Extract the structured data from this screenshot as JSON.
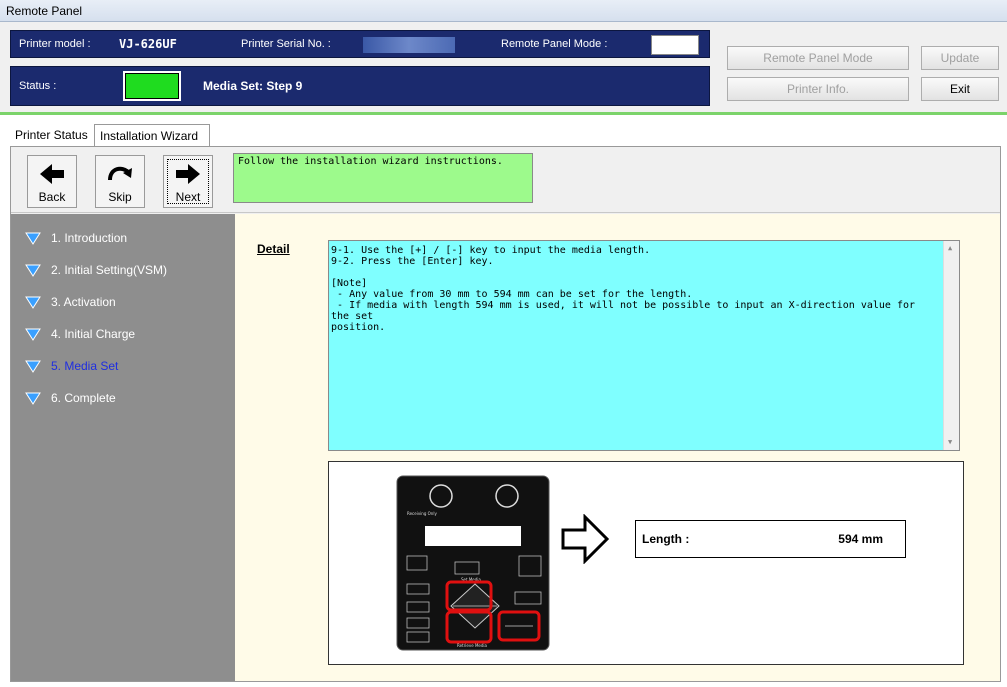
{
  "window": {
    "title": "Remote Panel"
  },
  "header": {
    "printer_model_label": "Printer model :",
    "printer_model": "VJ-626UF",
    "serial_label": "Printer Serial No. :",
    "remote_mode_label": "Remote Panel Mode :",
    "status_label": "Status :",
    "status_text": "Media Set: Step 9",
    "status_color": "#1fdc1f"
  },
  "buttons": {
    "remote_panel_mode": "Remote Panel Mode",
    "update": "Update",
    "printer_info": "Printer Info.",
    "exit": "Exit"
  },
  "tabs": [
    "Printer Status",
    "Installation Wizard"
  ],
  "toolbar": {
    "back": "Back",
    "skip": "Skip",
    "next": "Next",
    "message": "Follow the installation wizard instructions."
  },
  "steps": [
    {
      "label": "1. Introduction"
    },
    {
      "label": "2. Initial Setting(VSM)"
    },
    {
      "label": "3. Activation"
    },
    {
      "label": "4. Initial Charge"
    },
    {
      "label": "5. Media Set",
      "current": true
    },
    {
      "label": "6. Complete"
    }
  ],
  "detail": {
    "label": "Detail",
    "text": "9-1. Use the [+] / [-] key to input the media length.\n9-2. Press the [Enter] key.\n\n[Note]\n - Any value from 30 mm to 594 mm can be set for the length.\n - If media with length 594 mm is used, it will not be possible to input an X-direction value for the set\nposition."
  },
  "illustration": {
    "panel_labels": {
      "receiving_only": "Receiving Only",
      "set_media": "Set Media",
      "retrieve_media": "Retrieve Media"
    },
    "length_label": "Length :",
    "length_value": "594 mm"
  },
  "colors": {
    "header_navy": "#1b2a6e",
    "accent_green": "#7bd36a",
    "message_bg": "#9dfa8c",
    "detail_bg": "#7fffff",
    "sidebar_bg": "#8e8e8e",
    "current_step": "#1f2ee0",
    "highlight_red": "#e01010"
  }
}
